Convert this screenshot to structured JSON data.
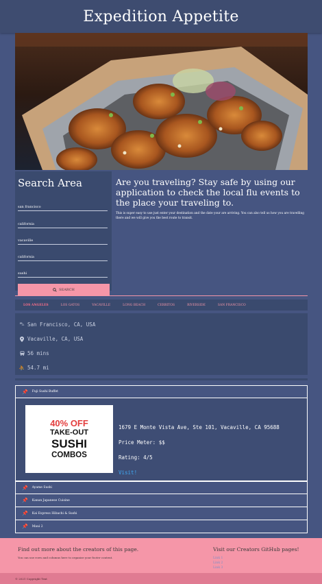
{
  "header": {
    "title": "Expedition Appetite"
  },
  "search": {
    "title": "Search Area",
    "fields": [
      "san francisco",
      "california",
      "vacaville",
      "california",
      "sushi"
    ],
    "button_label": "SEARCH"
  },
  "intro": {
    "heading": "Are you traveling? Stay safe by using our application to check the local flu events to the place your traveling to.",
    "body": "This is super easy to use just enter your destination and the date your are arriving. You can also tell us how you are travelling there and we will give you the best route to transit."
  },
  "tabs": [
    "LOS ANGELES",
    "LOS GATOS",
    "VACAVILLE",
    "LONG BEACH",
    "CERRITOS",
    "RIVERSIDE",
    "SAN FRANCISCO"
  ],
  "trip": {
    "origin": "San Francisco, CA, USA",
    "destination": "Vacaville, CA, USA",
    "duration": "56 mins",
    "distance": "54.7 mi"
  },
  "results": {
    "expanded": {
      "name": "Fuji Sushi Buffet",
      "address": "1679 E Monte Vista Ave, Ste 101, Vacaville,  CA 95688",
      "price": "Price Meter: $$",
      "rating": "Rating: 4/5",
      "visit": "Visit!",
      "ad": {
        "line1": "40% OFF",
        "line2": "TAKE-OUT",
        "line3": "SUSHI",
        "line4": "COMBOS"
      }
    },
    "others": [
      "Ayame Sushi",
      "Kanan Japanese Cuisine",
      "Kai Express Hibachi & Sushi",
      "Maui 2"
    ]
  },
  "footer": {
    "left_title": "Find out more about the creators of this page.",
    "left_sub": "You can use rows and columns here to organize your footer content.",
    "right_title": "Visit our Creators GitHub pages!",
    "links": [
      "Link 1",
      "Link 2",
      "Link 3"
    ]
  },
  "copyright": "© 2021 Copyright Text",
  "colors": {
    "accent": "#f596a8",
    "background": "#465581",
    "panel": "#3a4a6e",
    "link": "#3fa9f5"
  },
  "icons": [
    "search-icon",
    "car-icon",
    "pin-icon",
    "bus-icon",
    "walk-icon",
    "pushpin-icon"
  ]
}
